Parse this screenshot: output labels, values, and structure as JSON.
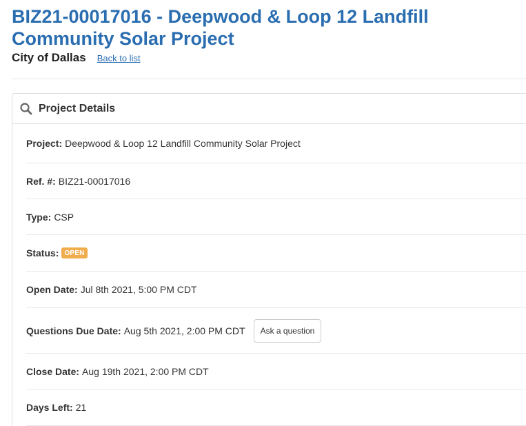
{
  "header": {
    "title": "BIZ21-00017016 - Deepwood & Loop 12 Landfill Community Solar Project",
    "agency": "City of Dallas",
    "back_link": "Back to list"
  },
  "panel": {
    "title": "Project Details",
    "icon": "search-icon",
    "fields": {
      "project": {
        "label": "Project:",
        "value": "Deepwood & Loop 12 Landfill Community Solar Project"
      },
      "ref": {
        "label": "Ref. #:",
        "value": "BIZ21-00017016"
      },
      "type": {
        "label": "Type:",
        "value": "CSP"
      },
      "status": {
        "label": "Status:",
        "value": "OPEN"
      },
      "open_date": {
        "label": "Open Date:",
        "value": "Jul 8th 2021, 5:00 PM CDT"
      },
      "questions_due": {
        "label": "Questions Due Date:",
        "value": "Aug 5th 2021, 2:00 PM CDT",
        "button": "Ask a question"
      },
      "close_date": {
        "label": "Close Date:",
        "value": "Aug 19th 2021, 2:00 PM CDT"
      },
      "days_left": {
        "label": "Days Left:",
        "value": "21"
      }
    }
  },
  "colors": {
    "title": "#2a6db0",
    "status_badge": "#f0ad4e"
  }
}
